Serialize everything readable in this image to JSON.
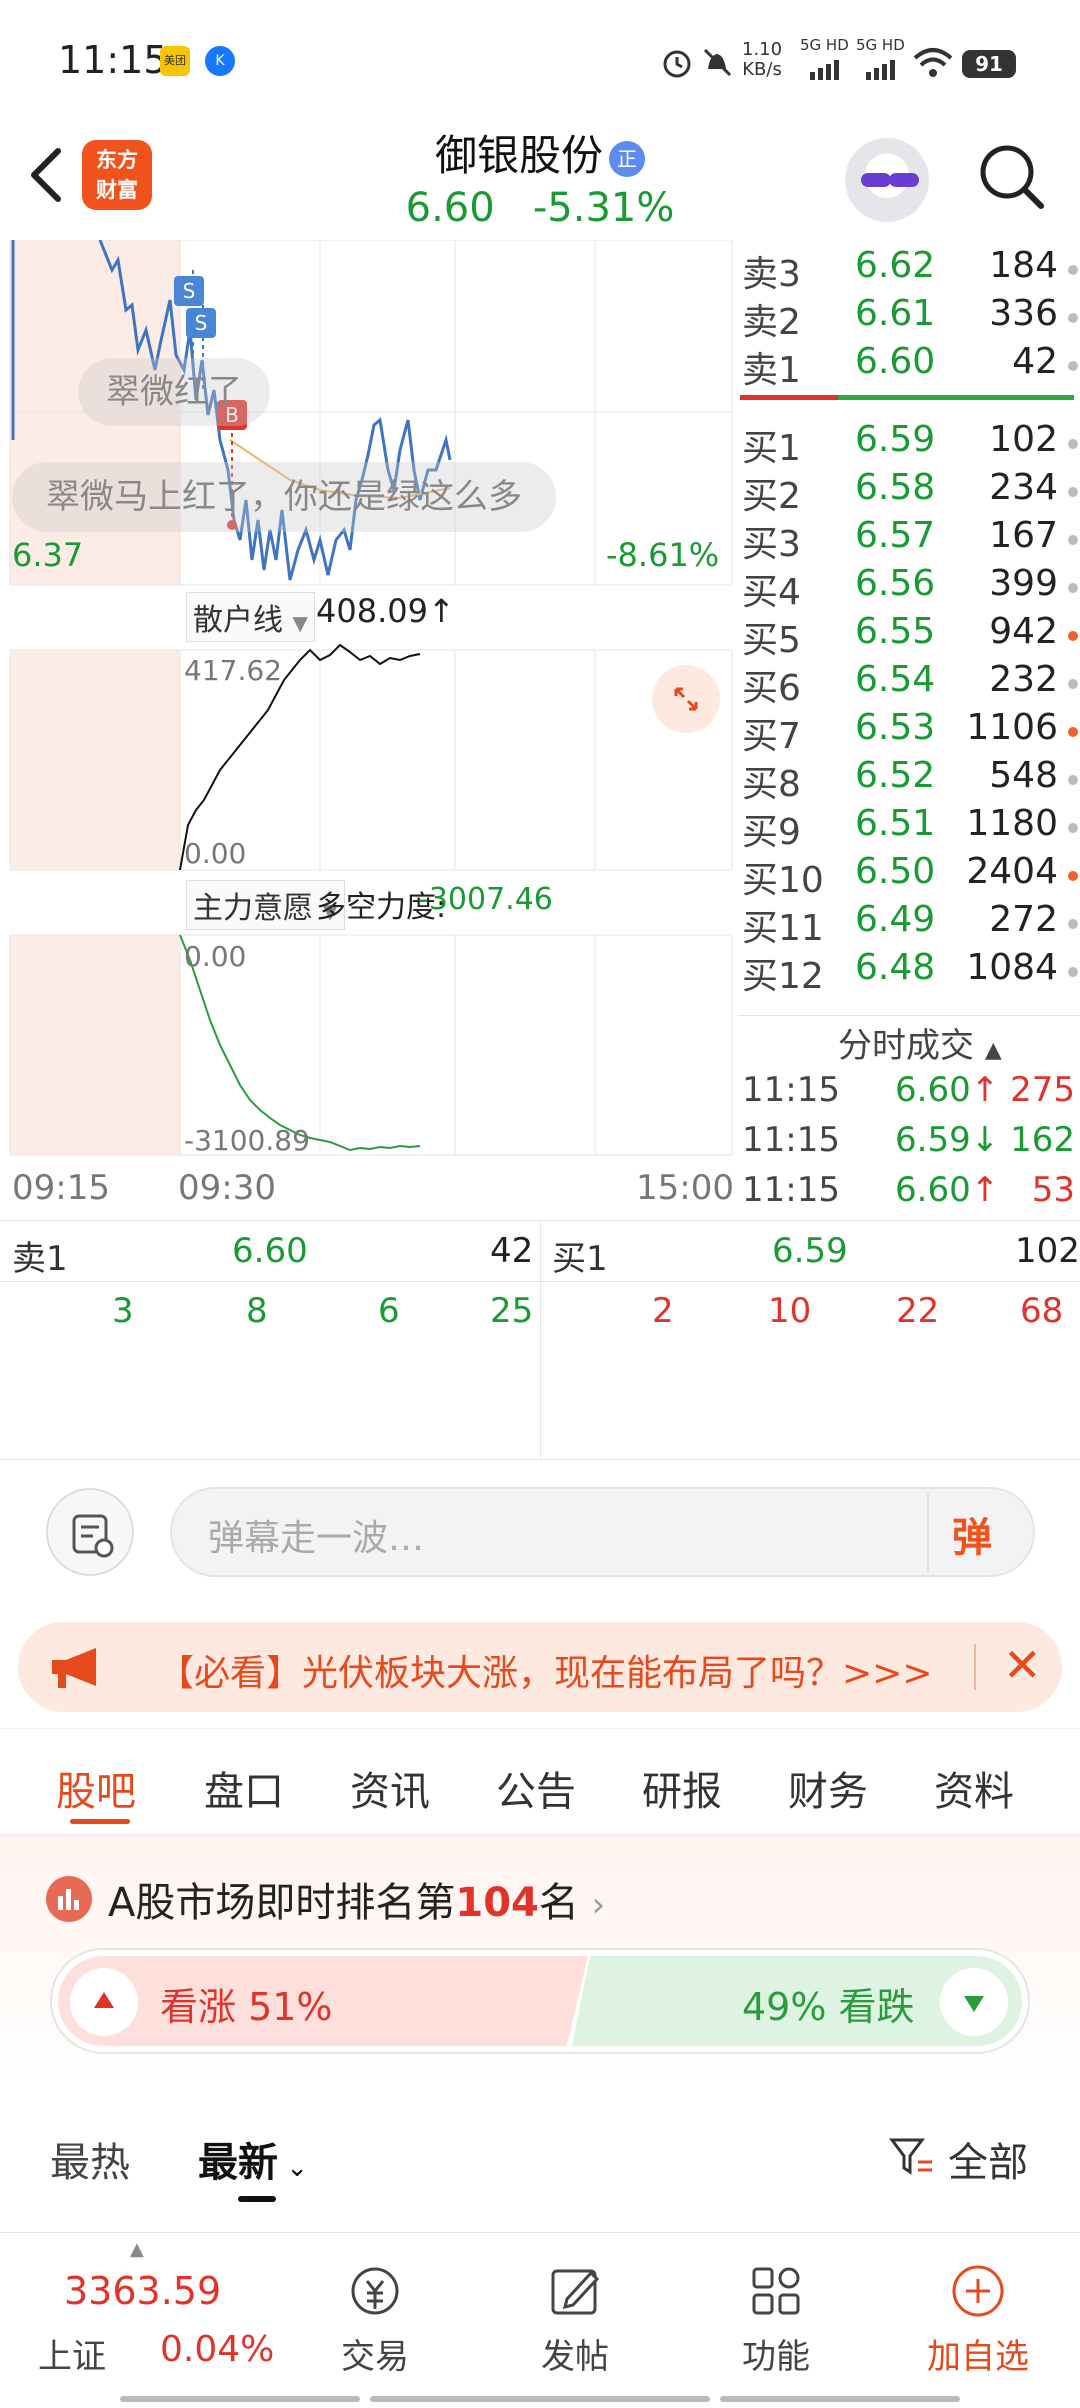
{
  "status_bar": {
    "time": "11:15",
    "net_speed_value": "1.10",
    "net_speed_unit": "KB/s",
    "signal1": "5G HD",
    "signal2": "5G HD",
    "battery": "91",
    "app1": "美团",
    "app2": "K"
  },
  "header": {
    "logo_text_1": "东方",
    "logo_text_2": "财富",
    "stock_name": "御银股份",
    "badge": "正",
    "price": "6.60",
    "change_pct": "-5.31%"
  },
  "chart": {
    "price_left": "6.37",
    "price_right": "-8.61%",
    "marker_s": "S",
    "marker_b": "B",
    "danmaku_1": "翠微红了",
    "danmaku_2": "翠微马上红了，你还是绿这么多",
    "indicator1_label": "散户线",
    "indicator1_value": "408.09",
    "indicator1_max": "417.62",
    "indicator1_min": "0.00",
    "indicator2_label": "主力意愿",
    "indicator2_name": "多空力度:",
    "indicator2_value": "-3007.46",
    "indicator2_max": "0.00",
    "indicator2_min": "-3100.89",
    "time_start": "09:15",
    "time_open": "09:30",
    "time_end": "15:00"
  },
  "order_book": {
    "asks": [
      {
        "label": "卖3",
        "price": "6.62",
        "volume": "184",
        "dot": "gray"
      },
      {
        "label": "卖2",
        "price": "6.61",
        "volume": "336",
        "dot": "gray"
      },
      {
        "label": "卖1",
        "price": "6.60",
        "volume": "42",
        "dot": "gray"
      }
    ],
    "bids": [
      {
        "label": "买1",
        "price": "6.59",
        "volume": "102",
        "dot": "gray"
      },
      {
        "label": "买2",
        "price": "6.58",
        "volume": "234",
        "dot": "gray"
      },
      {
        "label": "买3",
        "price": "6.57",
        "volume": "167",
        "dot": "gray"
      },
      {
        "label": "买4",
        "price": "6.56",
        "volume": "399",
        "dot": "gray"
      },
      {
        "label": "买5",
        "price": "6.55",
        "volume": "942",
        "dot": "orange"
      },
      {
        "label": "买6",
        "price": "6.54",
        "volume": "232",
        "dot": "gray"
      },
      {
        "label": "买7",
        "price": "6.53",
        "volume": "1106",
        "dot": "orange"
      },
      {
        "label": "买8",
        "price": "6.52",
        "volume": "548",
        "dot": "gray"
      },
      {
        "label": "买9",
        "price": "6.51",
        "volume": "1180",
        "dot": "gray"
      },
      {
        "label": "买10",
        "price": "6.50",
        "volume": "2404",
        "dot": "orange"
      },
      {
        "label": "买11",
        "price": "6.49",
        "volume": "272",
        "dot": "gray"
      },
      {
        "label": "买12",
        "price": "6.48",
        "volume": "1084",
        "dot": "gray"
      }
    ]
  },
  "ticks": {
    "title": "分时成交",
    "rows": [
      {
        "time": "11:15",
        "price": "6.60",
        "dir": "↑",
        "volume": "275",
        "color": "#e0342b"
      },
      {
        "time": "11:15",
        "price": "6.59",
        "dir": "↓",
        "volume": "162",
        "color": "#1a9a32"
      },
      {
        "time": "11:15",
        "price": "6.60",
        "dir": "↑",
        "volume": "53",
        "color": "#e0342b"
      }
    ]
  },
  "mini_book": {
    "ask_label": "卖1",
    "ask_price": "6.60",
    "ask_volume": "42",
    "bid_label": "买1",
    "bid_price": "6.59",
    "bid_volume": "102",
    "ask_orders": [
      "3",
      "8",
      "6",
      "25"
    ],
    "bid_orders": [
      "2",
      "10",
      "22",
      "68"
    ]
  },
  "danmaku_bar": {
    "placeholder": "弹幕走一波…",
    "send_label": "弹"
  },
  "notice": {
    "text": "【必看】光伏板块大涨，现在能布局了吗？>>>",
    "close": "✕"
  },
  "tabs": [
    "股吧",
    "盘口",
    "资讯",
    "公告",
    "研报",
    "财务",
    "资料"
  ],
  "rank": {
    "prefix": "A股市场即时排名第",
    "number": "104",
    "suffix": "名"
  },
  "vote": {
    "up_label": "看涨 51%",
    "down_label": "49% 看跌",
    "up_fraction": 0.51
  },
  "sort": {
    "hot": "最热",
    "new": "最新",
    "filter": "全部"
  },
  "bottom_nav": {
    "index_value": "3363.59",
    "index_name": "上证",
    "index_pct": "0.04%",
    "trade": "交易",
    "post": "发帖",
    "function": "功能",
    "add": "加自选"
  },
  "colors": {
    "up": "#e0342b",
    "down": "#1a9a32",
    "brand": "#f2521c"
  }
}
